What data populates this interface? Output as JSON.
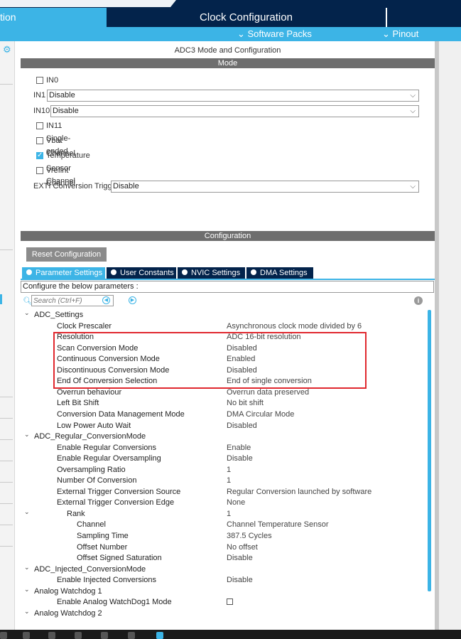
{
  "header": {
    "left_tab": "tion",
    "clock_tab": "Clock Configuration",
    "software_packs": "⌄ Software Packs",
    "pinout": "⌄ Pinout"
  },
  "panel": {
    "title": "ADC3 Mode and Configuration",
    "mode_header": "Mode",
    "config_header": "Configuration"
  },
  "mode": {
    "in0": "IN0",
    "in1_label": "IN1",
    "in1_value": "Disable",
    "in10_label": "IN10",
    "in10_value": "Disable",
    "in11": "IN11 Single-ended",
    "vbat": "Vbat Channel",
    "temp": "Temperature Sensor Channel",
    "vrefint": "Vrefint Channel",
    "exti_label": "EXTI Conversion Trigger",
    "exti_value": "Disable"
  },
  "config": {
    "reset_button": "Reset Configuration",
    "tabs": [
      "Parameter Settings",
      "User Constants",
      "NVIC Settings",
      "DMA Settings"
    ],
    "configure_label": "Configure the below parameters :",
    "search_placeholder": "Search (Ctrl+F)"
  },
  "tree": [
    {
      "k": "ADC_Settings",
      "v": "",
      "level": 0,
      "arrow": "⌄"
    },
    {
      "k": "Clock Prescaler",
      "v": "Asynchronous clock mode divided by 6",
      "level": 1
    },
    {
      "k": "Resolution",
      "v": "ADC 16-bit resolution",
      "level": 1
    },
    {
      "k": "Scan Conversion Mode",
      "v": "Disabled",
      "level": 1
    },
    {
      "k": "Continuous Conversion Mode",
      "v": "Enabled",
      "level": 1
    },
    {
      "k": "Discontinuous Conversion Mode",
      "v": "Disabled",
      "level": 1
    },
    {
      "k": "End Of Conversion Selection",
      "v": "End of single conversion",
      "level": 1
    },
    {
      "k": "Overrun behaviour",
      "v": "Overrun data preserved",
      "level": 1
    },
    {
      "k": "Left Bit Shift",
      "v": "No bit shift",
      "level": 1
    },
    {
      "k": "Conversion Data Management Mode",
      "v": "DMA Circular Mode",
      "level": 1
    },
    {
      "k": "Low Power Auto Wait",
      "v": "Disabled",
      "level": 1
    },
    {
      "k": "ADC_Regular_ConversionMode",
      "v": "",
      "level": 0,
      "arrow": "⌄"
    },
    {
      "k": "Enable Regular Conversions",
      "v": "Enable",
      "level": 1
    },
    {
      "k": "Enable Regular Oversampling",
      "v": "Disable",
      "level": 1
    },
    {
      "k": "Oversampling Ratio",
      "v": "1",
      "level": 1
    },
    {
      "k": "Number Of Conversion",
      "v": "1",
      "level": 1
    },
    {
      "k": "External Trigger Conversion Source",
      "v": "Regular Conversion launched by software",
      "level": 1
    },
    {
      "k": "External Trigger Conversion Edge",
      "v": "None",
      "level": 1
    },
    {
      "k": "Rank",
      "v": "1",
      "level": 2,
      "arrow": "⌄"
    },
    {
      "k": "Channel",
      "v": "Channel Temperature Sensor",
      "level": 3
    },
    {
      "k": "Sampling Time",
      "v": "387.5 Cycles",
      "level": 3
    },
    {
      "k": "Offset Number",
      "v": "No offset",
      "level": 3
    },
    {
      "k": "Offset Signed Saturation",
      "v": "Disable",
      "level": 3
    },
    {
      "k": "ADC_Injected_ConversionMode",
      "v": "",
      "level": 0,
      "arrow": "⌄"
    },
    {
      "k": "Enable Injected Conversions",
      "v": "Disable",
      "level": 1
    },
    {
      "k": "Analog Watchdog 1",
      "v": "",
      "level": 0,
      "arrow": "⌄"
    },
    {
      "k": "Enable Analog WatchDog1 Mode",
      "v": "",
      "level": 1,
      "checkbox": true
    },
    {
      "k": "Analog Watchdog 2",
      "v": "",
      "level": 0,
      "arrow": "⌄"
    }
  ]
}
